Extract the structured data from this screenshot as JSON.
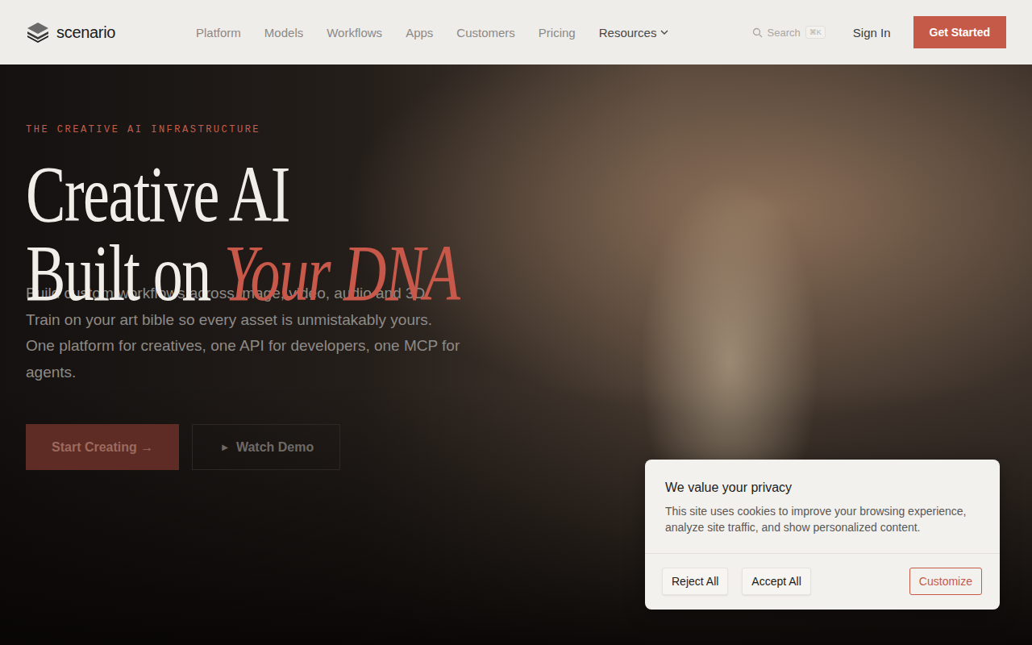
{
  "brand": {
    "name": "scenario"
  },
  "nav": {
    "items": [
      {
        "label": "Platform",
        "kind": "link"
      },
      {
        "label": "Models",
        "kind": "link"
      },
      {
        "label": "Workflows",
        "kind": "link"
      },
      {
        "label": "Apps",
        "kind": "link"
      },
      {
        "label": "Customers",
        "kind": "link"
      },
      {
        "label": "Pricing",
        "kind": "link"
      },
      {
        "label": "Resources",
        "kind": "menu"
      }
    ]
  },
  "search": {
    "label": "Search",
    "shortcut": "⌘K"
  },
  "sign_in": "Sign In",
  "get_started": "Get Started",
  "hero": {
    "eyebrow": "THE CREATIVE AI INFRASTRUCTURE",
    "title_line1": "Creative AI",
    "title_line2": "Built on",
    "title_accent": "Your DNA",
    "description": "Build custom workflows across image, video, audio and 3D. Train on your art bible so every asset is unmistakably yours. One platform for creatives, one API for developers, one MCP for agents.",
    "buttons": [
      {
        "label": "Start Creating →",
        "kind": "primary",
        "icon": ""
      },
      {
        "label": "Watch Demo",
        "kind": "secondary",
        "icon": "▶"
      }
    ]
  },
  "cookie": {
    "title": "We value your privacy",
    "text": "This site uses cookies to improve your browsing experience, analyze site traffic, and show personalized content.",
    "buttons": [
      {
        "label": "Reject All",
        "kind": "plain"
      },
      {
        "label": "Accept All",
        "kind": "plain"
      },
      {
        "label": "Customize",
        "kind": "outline"
      }
    ]
  }
}
